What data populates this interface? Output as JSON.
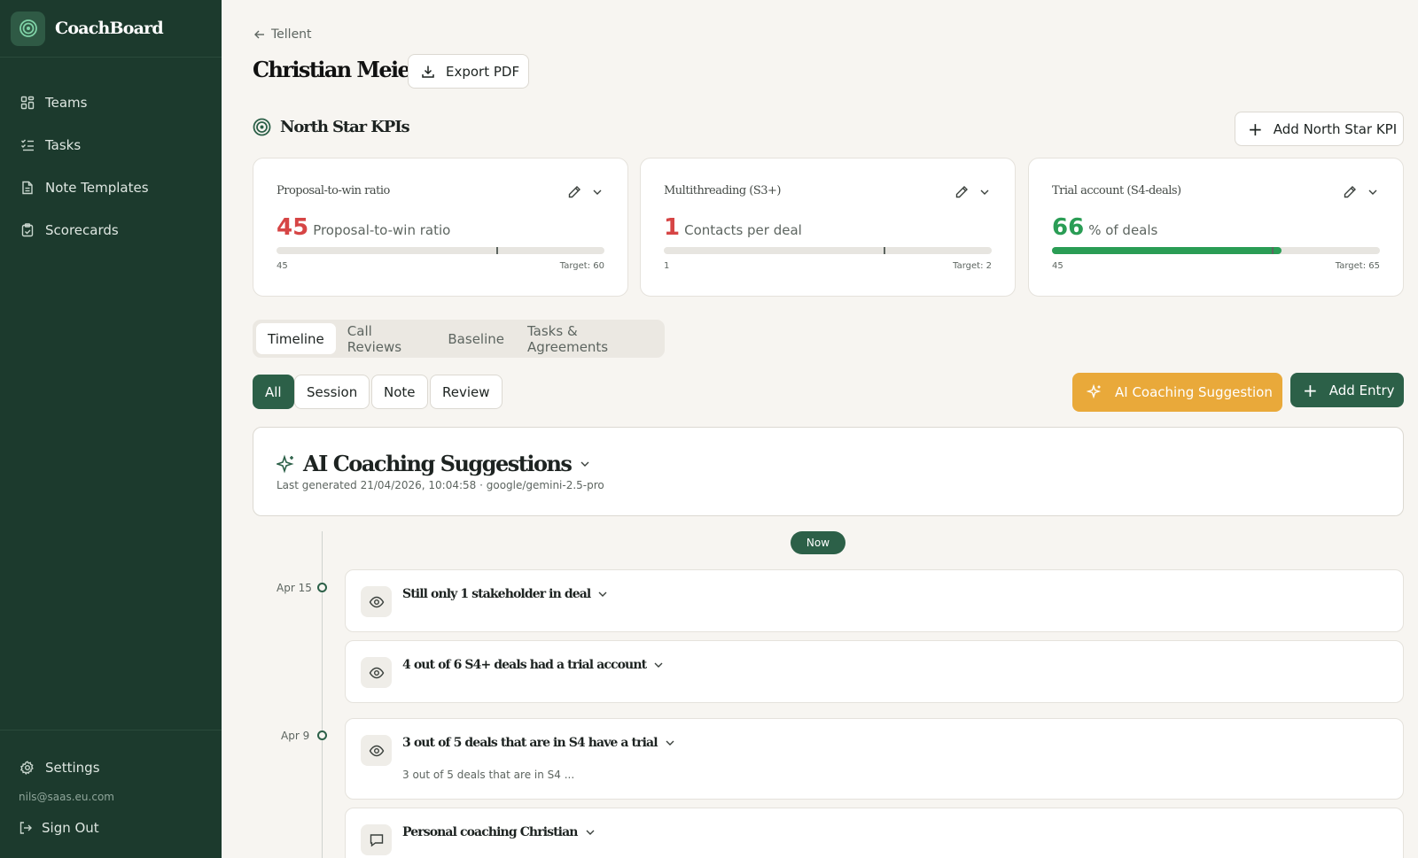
{
  "brand": {
    "name": "CoachBoard"
  },
  "sidebar": {
    "items": [
      {
        "label": "Teams",
        "icon": "grid-icon"
      },
      {
        "label": "Tasks",
        "icon": "list-check-icon"
      },
      {
        "label": "Note Templates",
        "icon": "document-icon"
      },
      {
        "label": "Scorecards",
        "icon": "clipboard-icon"
      }
    ],
    "settings_label": "Settings",
    "user_email": "nils@saas.eu.com",
    "signout_label": "Sign Out"
  },
  "header": {
    "back_label": "Tellent",
    "title": "Christian Meier",
    "export_label": "Export PDF"
  },
  "kpis": {
    "section_title": "North Star KPIs",
    "add_label": "Add North Star KPI",
    "cards": [
      {
        "title": "Proposal-to-win ratio",
        "value": "45",
        "unit": "Proposal-to-win ratio",
        "low": "45",
        "target": "Target: 60",
        "value_color": "#d64545",
        "fill_fraction": 0,
        "target_fraction": 0.67
      },
      {
        "title": "Multithreading (S3+)",
        "value": "1",
        "unit": "Contacts per deal",
        "low": "1",
        "target": "Target: 2",
        "value_color": "#d64545",
        "fill_fraction": 0,
        "target_fraction": 0.67
      },
      {
        "title": "Trial account (S4-deals)",
        "value": "66",
        "unit": "% of deals",
        "low": "45",
        "target": "Target: 65",
        "value_color": "#2a9d55",
        "fill_fraction": 0.7,
        "target_fraction": 0.67
      }
    ]
  },
  "tabs": [
    "Timeline",
    "Call Reviews",
    "Baseline",
    "Tasks & Agreements"
  ],
  "filters": [
    "All",
    "Session",
    "Note",
    "Review"
  ],
  "actions": {
    "ai_label": "AI Coaching Suggestion",
    "add_entry_label": "Add Entry"
  },
  "ai_panel": {
    "title": "AI Coaching Suggestions",
    "subtitle": "Last generated 21/04/2026, 10:04:58 · google/gemini-2.5-pro"
  },
  "timeline": {
    "now_label": "Now",
    "dates": [
      "Apr 15",
      "Apr 9"
    ],
    "entries": [
      {
        "title": "Still only 1 stakeholder in deal",
        "icon": "eye-icon"
      },
      {
        "title": "4 out of 6 S4+ deals had a trial account",
        "icon": "eye-icon"
      },
      {
        "title": "3 out of 5 deals that are in S4 have a trial",
        "subtitle": "3 out of 5 deals that are in S4 ...",
        "icon": "eye-icon"
      },
      {
        "title": "Personal coaching Christian",
        "icon": "chat-icon"
      }
    ]
  },
  "colors": {
    "sidebar_bg": "#1c3a2d",
    "accent_green": "#2c6048",
    "ai_orange": "#e9a93a",
    "negative": "#d64545",
    "positive": "#2a9d55"
  }
}
